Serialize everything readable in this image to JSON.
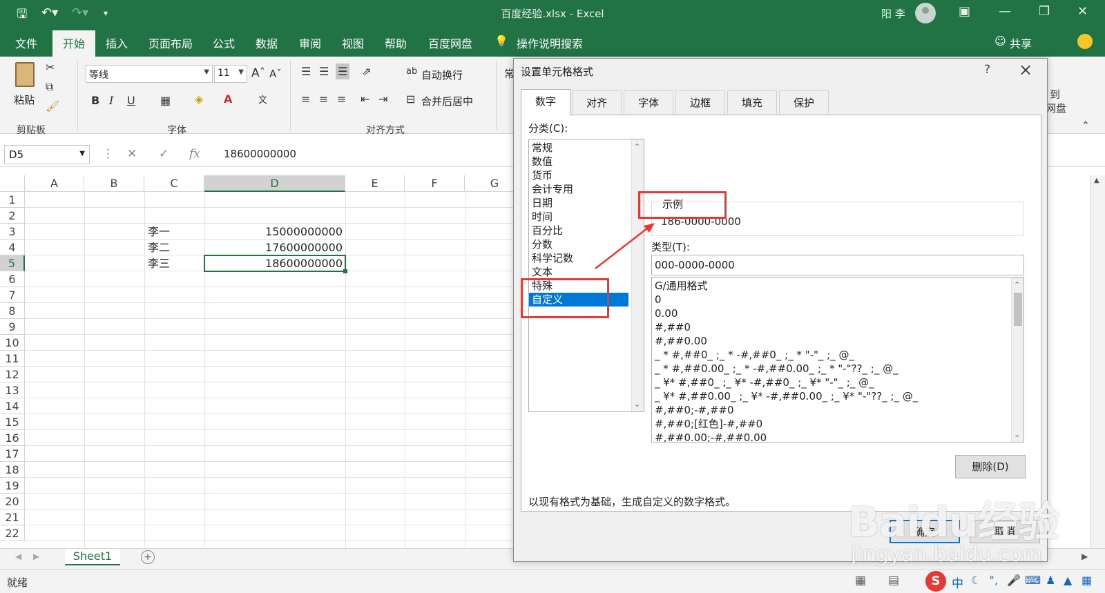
{
  "titlebar": {
    "title": "百度经验.xlsx  -  Excel",
    "user": "阳 李"
  },
  "tabs": [
    "文件",
    "开始",
    "插入",
    "页面布局",
    "公式",
    "数据",
    "审阅",
    "视图",
    "帮助",
    "百度网盘"
  ],
  "tell_me": "操作说明搜索",
  "share": "共享",
  "ribbon": {
    "paste": "粘贴",
    "font_name": "等线",
    "font_size": "11",
    "wrap_text": "自动换行",
    "merge_center": "合并后居中",
    "groups": {
      "clipboard": "剪贴板",
      "font": "字体",
      "alignment": "对齐方式"
    },
    "number_partial": "常",
    "baidu_partial_1": "到",
    "baidu_partial_2": "网盘"
  },
  "formula_bar": {
    "name_box": "D5",
    "value": "18600000000"
  },
  "grid": {
    "columns": [
      "A",
      "B",
      "C",
      "D",
      "E",
      "F",
      "G"
    ],
    "rows": [
      "1",
      "2",
      "3",
      "4",
      "5",
      "6",
      "7",
      "8",
      "9",
      "10",
      "11",
      "12",
      "13",
      "14",
      "15",
      "16",
      "17",
      "18",
      "19",
      "20",
      "21",
      "22"
    ],
    "cells": {
      "C3": "李一",
      "D3": "15000000000",
      "C4": "李二",
      "D4": "17600000000",
      "C5": "李三",
      "D5": "18600000000"
    }
  },
  "sheet_tab": "Sheet1",
  "status": "就绪",
  "dialog": {
    "title": "设置单元格格式",
    "help": "?",
    "tabs": [
      "数字",
      "对齐",
      "字体",
      "边框",
      "填充",
      "保护"
    ],
    "category_label": "分类(C):",
    "categories": [
      "常规",
      "数值",
      "货币",
      "会计专用",
      "日期",
      "时间",
      "百分比",
      "分数",
      "科学记数",
      "文本",
      "特殊",
      "自定义"
    ],
    "selected_category": "自定义",
    "sample_label": "示例",
    "sample_value": "186-0000-0000",
    "type_label": "类型(T):",
    "type_value": "000-0000-0000",
    "formats": [
      "G/通用格式",
      "0",
      "0.00",
      "#,##0",
      "#,##0.00",
      "_ * #,##0_ ;_ * -#,##0_ ;_ * \"-\"_ ;_ @_",
      "_ * #,##0.00_ ;_ * -#,##0.00_ ;_ * \"-\"??_ ;_ @_",
      "_ ¥* #,##0_ ;_ ¥* -#,##0_ ;_ ¥* \"-\"_ ;_ @_",
      "_ ¥* #,##0.00_ ;_ ¥* -#,##0.00_ ;_ ¥* \"-\"??_ ;_ @_",
      "#,##0;-#,##0",
      "#,##0;[红色]-#,##0",
      "#,##0.00;-#,##0.00"
    ],
    "delete_button": "删除(D)",
    "description": "以现有格式为基础，生成自定义的数字格式。",
    "ok": "确定",
    "cancel": "取消"
  },
  "watermark": {
    "logo": "Baidu经验",
    "url": "jingyan.baidu.com"
  },
  "ime": [
    "中"
  ],
  "colors": {
    "excel_green": "#217346",
    "highlight": "#0078d7",
    "annotation_red": "#e53935"
  }
}
